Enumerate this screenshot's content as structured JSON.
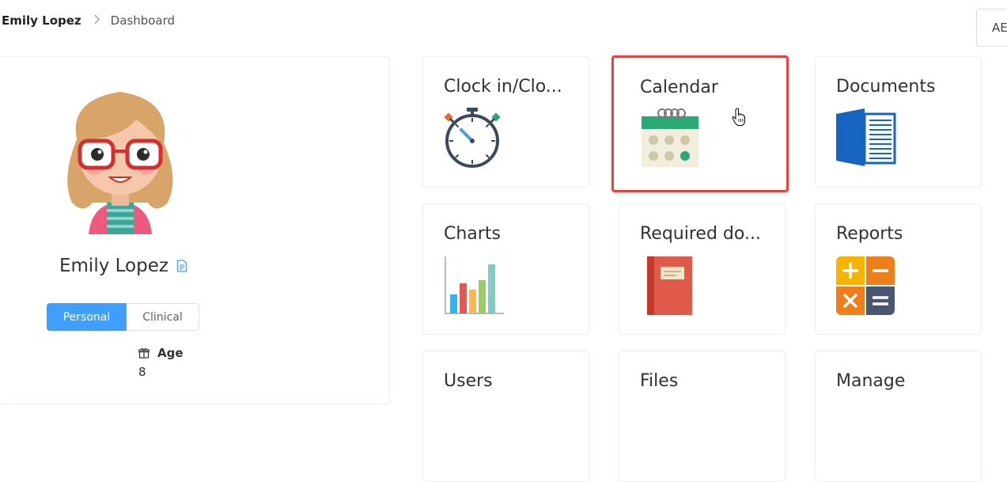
{
  "breadcrumb": {
    "user": "Emily Lopez",
    "separator": ">",
    "page": "Dashboard"
  },
  "top_button": {
    "label": "AE"
  },
  "profile": {
    "name": "Emily Lopez",
    "tabs": [
      {
        "label": "Personal",
        "active": true
      },
      {
        "label": "Clinical",
        "active": false
      }
    ],
    "age_label": "Age",
    "age_value": "8"
  },
  "cards": [
    {
      "title": "Clock in/Clo...",
      "icon": "stopwatch-icon"
    },
    {
      "title": "Calendar",
      "icon": "calendar-icon",
      "selected": true
    },
    {
      "title": "Documents",
      "icon": "documents-icon"
    },
    {
      "title": "Charts",
      "icon": "bar-chart-icon"
    },
    {
      "title": "Required do...",
      "icon": "notebook-icon"
    },
    {
      "title": "Reports",
      "icon": "calculator-icon"
    },
    {
      "title": "Users",
      "icon": ""
    },
    {
      "title": "Files",
      "icon": ""
    },
    {
      "title": "Manage",
      "icon": ""
    }
  ],
  "colors": {
    "primary": "#409eff",
    "selection": "#e0463f",
    "border": "#ebeef5"
  }
}
